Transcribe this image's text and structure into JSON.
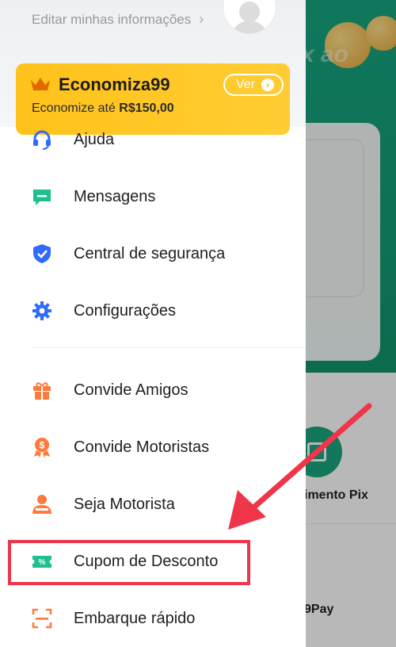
{
  "drawer": {
    "edit_info_label": "Editar minhas informações",
    "promo": {
      "title": "Economiza99",
      "subtitle_prefix": "Economize até",
      "subtitle_amount": "R$150,00",
      "button_label": "Ver"
    },
    "menu_items": [
      {
        "label": "Ajuda",
        "icon": "headset-icon",
        "color": "#2f6bff"
      },
      {
        "label": "Mensagens",
        "icon": "message-icon",
        "color": "#1fbf8f"
      },
      {
        "label": "Central de segurança",
        "icon": "shield-check-icon",
        "color": "#2f6bff"
      },
      {
        "label": "Configurações",
        "icon": "gear-icon",
        "color": "#2f6bff"
      },
      {
        "label": "Convide Amigos",
        "icon": "gift-icon",
        "color": "#ff7a3d"
      },
      {
        "label": "Convide Motoristas",
        "icon": "dollar-medal-icon",
        "color": "#ff7a3d"
      },
      {
        "label": "Seja Motorista",
        "icon": "driver-icon",
        "color": "#ff7a3d"
      },
      {
        "label": "Cupom de Desconto",
        "icon": "coupon-icon",
        "color": "#1fbf8f"
      },
      {
        "label": "Embarque rápido",
        "icon": "scan-icon",
        "color": "#ff7a3d"
      }
    ]
  },
  "background": {
    "banner_fragment": "x ao",
    "pix_label": "imento Pix",
    "pay_label": "9Pay"
  },
  "colors": {
    "accent_green": "#17a680",
    "promo_yellow": "#ffc21a",
    "highlight_red": "#f0344a"
  }
}
